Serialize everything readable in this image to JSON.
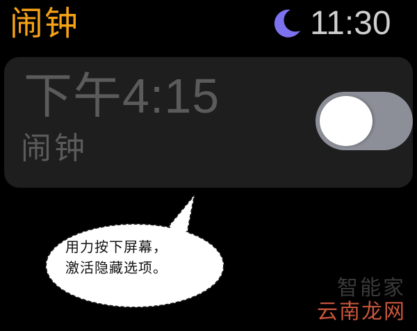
{
  "header": {
    "app_title": "闹钟",
    "status_icon": "moon-icon",
    "time": "11:30"
  },
  "alarm": {
    "time": "下午4:15",
    "label": "闹钟",
    "enabled": false
  },
  "callout": {
    "line1": "用力按下屏幕，",
    "line2": "激活隐藏选项。"
  },
  "watermark": {
    "line1": "智能家",
    "line2": "云南龙网"
  },
  "colors": {
    "accent": "#f5a216",
    "moon": "#7d72ee",
    "toggle_off": "#8c8f98",
    "card": "#1e1e1e"
  }
}
